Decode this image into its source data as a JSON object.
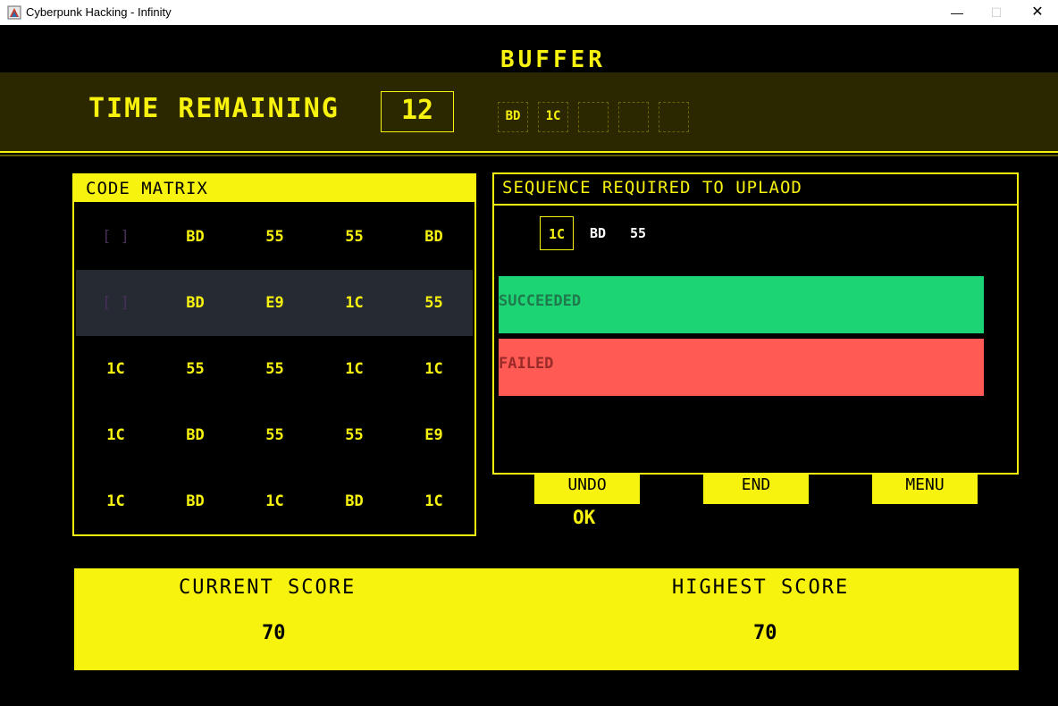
{
  "window": {
    "title": "Cyberpunk Hacking - Infinity",
    "minimize": "—",
    "maximize": "☐",
    "close": "✕"
  },
  "buffer": {
    "title": "BUFFER",
    "slots": [
      "BD",
      "1C",
      "",
      "",
      ""
    ]
  },
  "timer": {
    "label": "TIME REMAINING",
    "value": "12"
  },
  "matrix": {
    "title": "CODE MATRIX",
    "rows": [
      [
        "[ ]",
        "BD",
        "55",
        "55",
        "BD"
      ],
      [
        "[ ]",
        "BD",
        "E9",
        "1C",
        "55"
      ],
      [
        "1C",
        "55",
        "55",
        "1C",
        "1C"
      ],
      [
        "1C",
        "BD",
        "55",
        "55",
        "E9"
      ],
      [
        "1C",
        "BD",
        "1C",
        "BD",
        "1C"
      ]
    ]
  },
  "sequence": {
    "title": "SEQUENCE REQUIRED TO UPLAOD",
    "codes": [
      "1C",
      "BD",
      "55"
    ],
    "succeeded_label": "SUCCEEDED",
    "failed_label": "FAILED"
  },
  "actions": {
    "undo": "UNDO",
    "end": "END",
    "menu": "MENU",
    "status": "OK"
  },
  "scores": {
    "current_label": "CURRENT SCORE",
    "current_value": "70",
    "highest_label": "HIGHEST SCORE",
    "highest_value": "70"
  },
  "colors": {
    "accent": "#f8f20f",
    "succeeded": "#1dd474",
    "failed": "#ff5a54",
    "background": "#000000"
  }
}
